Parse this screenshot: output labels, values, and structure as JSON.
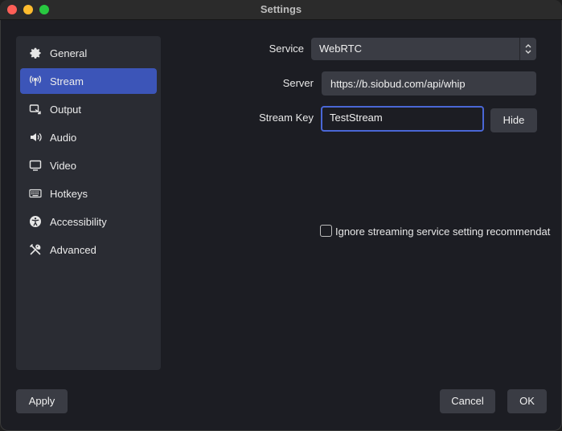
{
  "window": {
    "title": "Settings"
  },
  "sidebar": {
    "items": [
      {
        "label": "General",
        "icon": "gear-icon"
      },
      {
        "label": "Stream",
        "icon": "antenna-icon",
        "active": true
      },
      {
        "label": "Output",
        "icon": "output-icon"
      },
      {
        "label": "Audio",
        "icon": "speaker-icon"
      },
      {
        "label": "Video",
        "icon": "monitor-icon"
      },
      {
        "label": "Hotkeys",
        "icon": "keyboard-icon"
      },
      {
        "label": "Accessibility",
        "icon": "accessibility-icon"
      },
      {
        "label": "Advanced",
        "icon": "tools-icon"
      }
    ]
  },
  "form": {
    "service_label": "Service",
    "service_value": "WebRTC",
    "server_label": "Server",
    "server_value": "https://b.siobud.com/api/whip",
    "stream_key_label": "Stream Key",
    "stream_key_value": "TestStream",
    "hide_button": "Hide",
    "ignore_checkbox_label": "Ignore streaming service setting recommendat",
    "ignore_checked": false
  },
  "footer": {
    "apply_label": "Apply",
    "cancel_label": "Cancel",
    "ok_label": "OK"
  },
  "colors": {
    "accent": "#3c55b8",
    "focus_border": "#4a67d6",
    "panel": "#2a2c33",
    "background": "#1c1d23"
  }
}
